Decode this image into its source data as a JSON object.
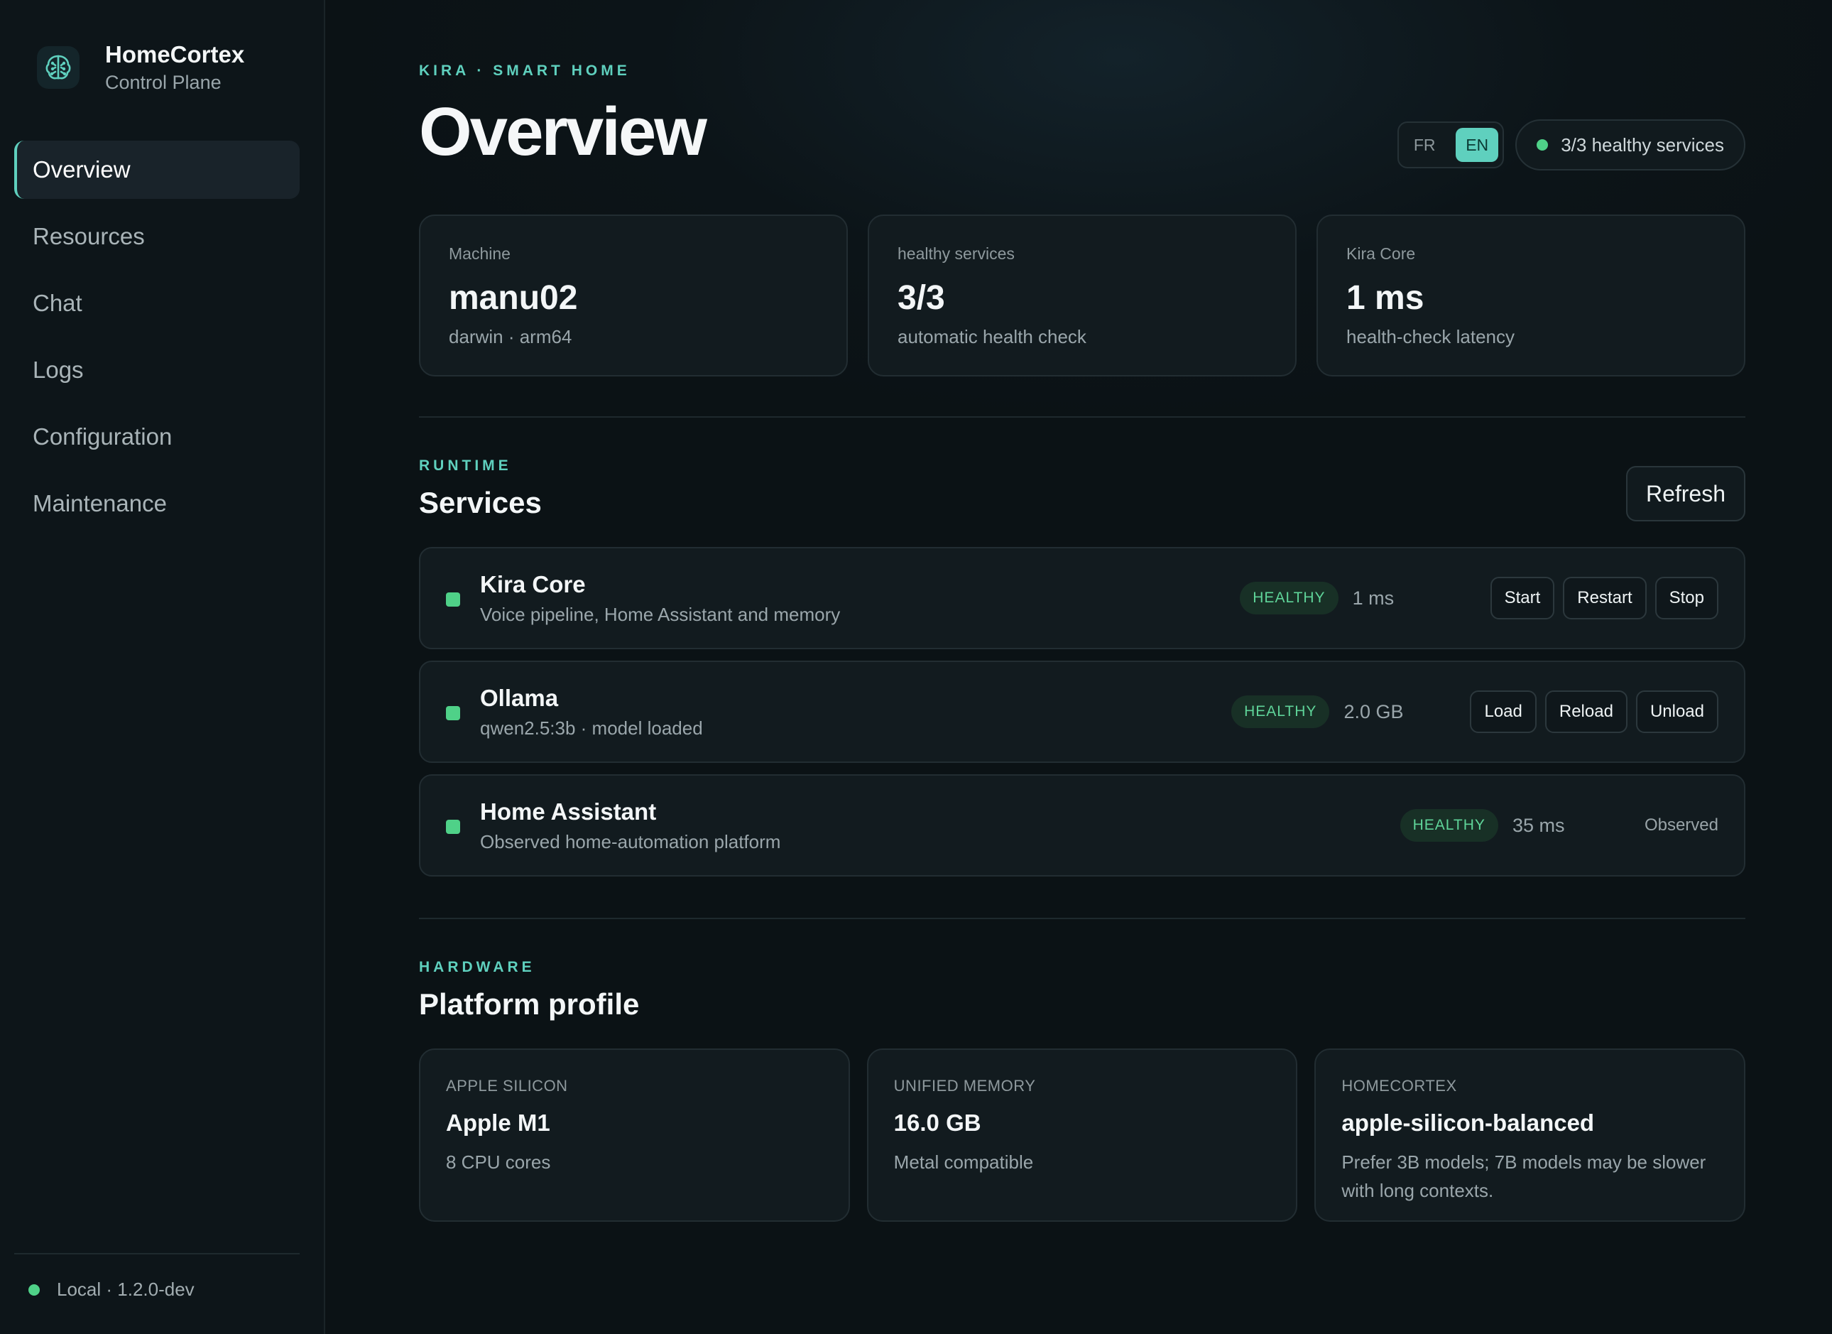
{
  "brand": {
    "name": "HomeCortex",
    "subtitle": "Control Plane",
    "logo_icon": "brain-icon",
    "accent": "#5fd0be"
  },
  "nav": {
    "items": [
      {
        "label": "Overview",
        "active": true
      },
      {
        "label": "Resources",
        "active": false
      },
      {
        "label": "Chat",
        "active": false
      },
      {
        "label": "Logs",
        "active": false
      },
      {
        "label": "Configuration",
        "active": false
      },
      {
        "label": "Maintenance",
        "active": false
      }
    ]
  },
  "footer": {
    "status": "Local · 1.2.0-dev",
    "status_color": "#4fd188"
  },
  "header": {
    "eyebrow": "KIRA · SMART HOME",
    "title": "Overview",
    "lang": {
      "options": [
        "FR",
        "EN"
      ],
      "selected": "EN"
    },
    "health_pill": "3/3 healthy services"
  },
  "stats": [
    {
      "label": "Machine",
      "value": "manu02",
      "sub": "darwin · arm64"
    },
    {
      "label": "healthy services",
      "value": "3/3",
      "sub": "automatic health check"
    },
    {
      "label": "Kira Core",
      "value": "1 ms",
      "sub": "health-check latency"
    }
  ],
  "services_section": {
    "eyebrow": "RUNTIME",
    "title": "Services",
    "refresh_label": "Refresh",
    "items": [
      {
        "name": "Kira Core",
        "description": "Voice pipeline, Home Assistant and memory",
        "status": "HEALTHY",
        "metric": "1 ms",
        "actions": [
          "Start",
          "Restart",
          "Stop"
        ]
      },
      {
        "name": "Ollama",
        "description": "qwen2.5:3b · model loaded",
        "status": "HEALTHY",
        "metric": "2.0 GB",
        "actions": [
          "Load",
          "Reload",
          "Unload"
        ]
      },
      {
        "name": "Home Assistant",
        "description": "Observed home-automation platform",
        "status": "HEALTHY",
        "metric": "35 ms",
        "observed_label": "Observed"
      }
    ]
  },
  "hardware_section": {
    "eyebrow": "HARDWARE",
    "title": "Platform profile",
    "cards": [
      {
        "label": "APPLE SILICON",
        "value": "Apple M1",
        "sub": "8 CPU cores"
      },
      {
        "label": "UNIFIED MEMORY",
        "value": "16.0 GB",
        "sub": "Metal compatible"
      },
      {
        "label": "HOMECORTEX",
        "value": "apple-silicon-balanced",
        "sub": "Prefer 3B models; 7B models may be slower with long contexts."
      }
    ]
  }
}
